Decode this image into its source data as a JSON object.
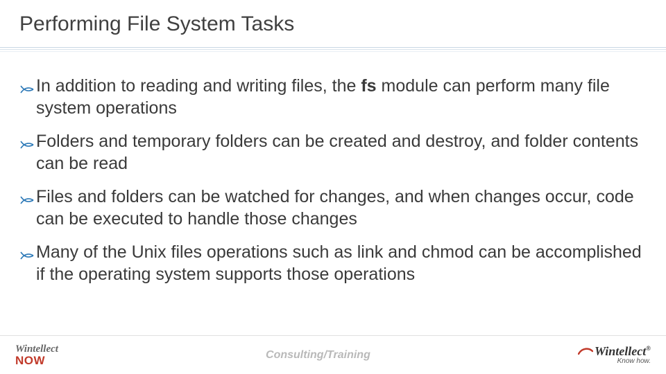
{
  "title": "Performing File System Tasks",
  "bullets": [
    {
      "pre": "In addition to reading and writing files, the ",
      "bold": "fs",
      "post": " module can perform many file system operations"
    },
    {
      "pre": "Folders and temporary folders can be created and destroy, and folder contents can be read",
      "bold": "",
      "post": ""
    },
    {
      "pre": "Files and folders can be watched for changes, and when changes occur, code can be executed to handle those changes",
      "bold": "",
      "post": ""
    },
    {
      "pre": "Many of the Unix files operations such as link and chmod can be accomplished if the operating system supports those operations",
      "bold": "",
      "post": ""
    }
  ],
  "footer": {
    "center": "Consulting/Training",
    "left_logo_top": "Wintellect",
    "left_logo_bottom": "NOW",
    "right_logo_brand": "Wintellect",
    "right_logo_reg": "®",
    "right_logo_tag": "Know how."
  },
  "colors": {
    "bullet_icon": "#2e7ab8"
  }
}
